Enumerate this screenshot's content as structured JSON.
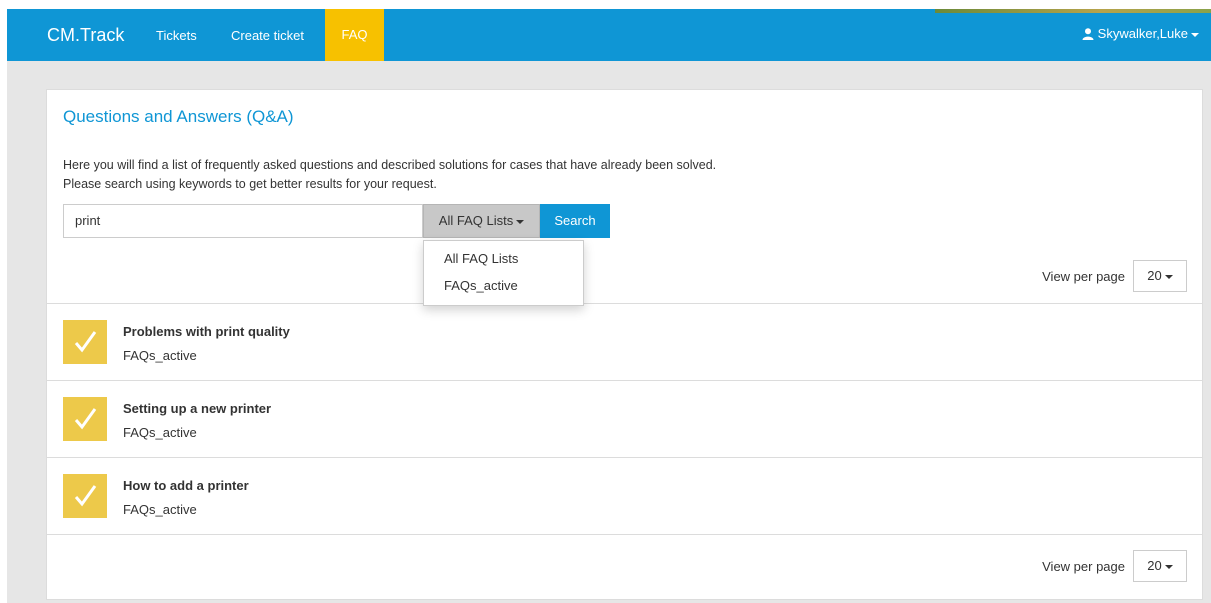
{
  "navbar": {
    "brand": "CM.Track",
    "links": [
      {
        "label": "Tickets"
      },
      {
        "label": "Create ticket"
      },
      {
        "label": "FAQ",
        "active": true
      }
    ],
    "user": {
      "name": "Skywalker,Luke",
      "icon": "user-icon"
    },
    "colors": {
      "bar": "#0f96d5",
      "active": "#f7c100"
    }
  },
  "panel": {
    "title": "Questions and Answers (Q&A)",
    "description": [
      "Here you will find a list of frequently asked questions and described solutions for cases that have already been solved.",
      "Please search using keywords to get better results for your request."
    ]
  },
  "search": {
    "value": "print",
    "list_selector": "All FAQ Lists",
    "button": "Search",
    "dropdown_options": [
      "All FAQ Lists",
      "FAQs_active"
    ]
  },
  "pagination": {
    "label": "View per page",
    "value": "20"
  },
  "results": [
    {
      "title": "Problems with print quality",
      "list": "FAQs_active",
      "icon": "checkmark-icon"
    },
    {
      "title": "Setting up a new printer",
      "list": "FAQs_active",
      "icon": "checkmark-icon"
    },
    {
      "title": "How to add a printer",
      "list": "FAQs_active",
      "icon": "checkmark-icon"
    }
  ]
}
